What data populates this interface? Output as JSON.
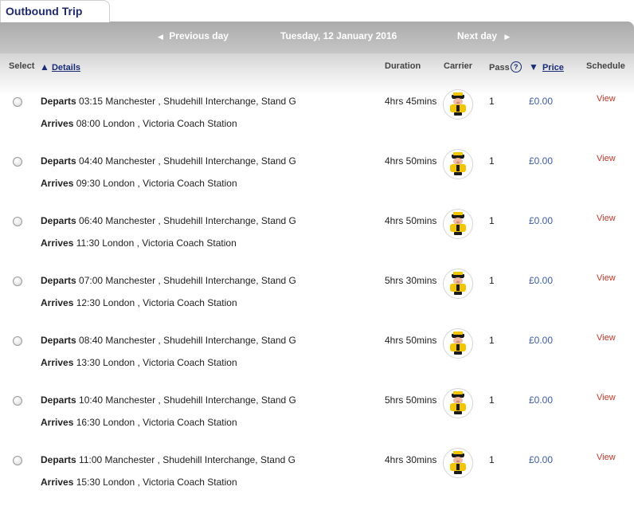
{
  "tab": {
    "title": "Outbound Trip"
  },
  "nav": {
    "previous_label": "Previous day",
    "date": "Tuesday, 12 January 2016",
    "next_label": "Next day"
  },
  "headers": {
    "select": "Select",
    "details": "Details",
    "duration": "Duration",
    "carrier": "Carrier",
    "pass": "Pass",
    "pass_help": "?",
    "price": "Price",
    "schedule": "Schedule"
  },
  "labels": {
    "departs": "Departs",
    "arrives": "Arrives"
  },
  "journeys": [
    {
      "dep_time": "03:15",
      "dep_place": "Manchester , Shudehill Interchange, Stand G",
      "arr_time": "08:00",
      "arr_place": "London , Victoria Coach Station",
      "duration": "4hrs 45mins",
      "pass": "1",
      "price": "£0.00",
      "schedule": "View"
    },
    {
      "dep_time": "04:40",
      "dep_place": "Manchester , Shudehill Interchange, Stand G",
      "arr_time": "09:30",
      "arr_place": "London , Victoria Coach Station",
      "duration": "4hrs 50mins",
      "pass": "1",
      "price": "£0.00",
      "schedule": "View"
    },
    {
      "dep_time": "06:40",
      "dep_place": "Manchester , Shudehill Interchange, Stand G",
      "arr_time": "11:30",
      "arr_place": "London , Victoria Coach Station",
      "duration": "4hrs 50mins",
      "pass": "1",
      "price": "£0.00",
      "schedule": "View"
    },
    {
      "dep_time": "07:00",
      "dep_place": "Manchester , Shudehill Interchange, Stand G",
      "arr_time": "12:30",
      "arr_place": "London , Victoria Coach Station",
      "duration": "5hrs 30mins",
      "pass": "1",
      "price": "£0.00",
      "schedule": "View"
    },
    {
      "dep_time": "08:40",
      "dep_place": "Manchester , Shudehill Interchange, Stand G",
      "arr_time": "13:30",
      "arr_place": "London , Victoria Coach Station",
      "duration": "4hrs 50mins",
      "pass": "1",
      "price": "£0.00",
      "schedule": "View"
    },
    {
      "dep_time": "10:40",
      "dep_place": "Manchester , Shudehill Interchange, Stand G",
      "arr_time": "16:30",
      "arr_place": "London , Victoria Coach Station",
      "duration": "5hrs 50mins",
      "pass": "1",
      "price": "£0.00",
      "schedule": "View"
    },
    {
      "dep_time": "11:00",
      "dep_place": "Manchester , Shudehill Interchange, Stand G",
      "arr_time": "15:30",
      "arr_place": "London , Victoria Coach Station",
      "duration": "4hrs 30mins",
      "pass": "1",
      "price": "£0.00",
      "schedule": "View"
    }
  ],
  "carrier_icon": "megabus-mascot-icon",
  "colors": {
    "link": "#1a2b78",
    "price": "#3b5ba9",
    "view": "#c0392b",
    "tab_title": "#1f2a6e"
  }
}
